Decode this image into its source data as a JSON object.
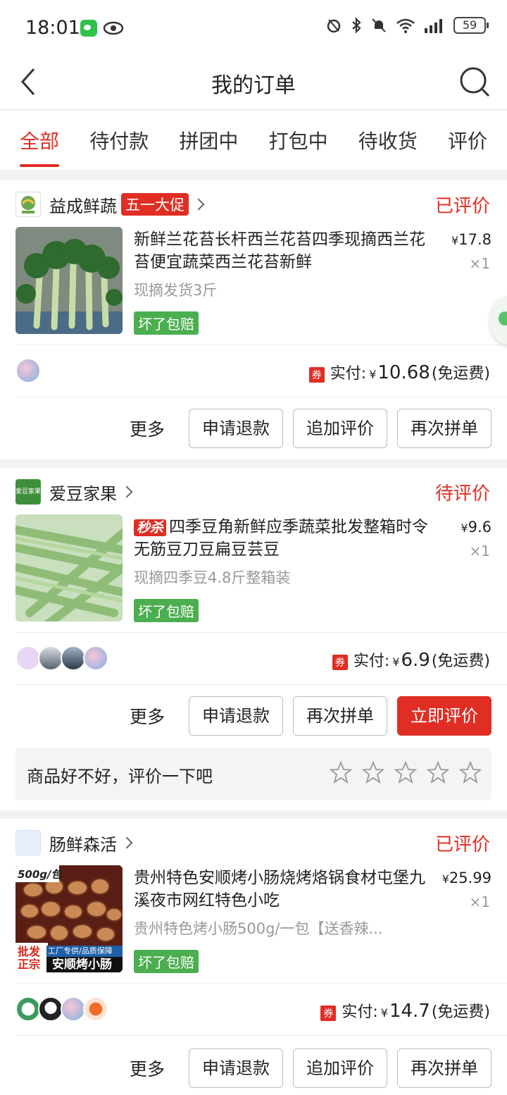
{
  "status_bar": {
    "time": "18:01",
    "battery": "59"
  },
  "header": {
    "title": "我的订单"
  },
  "tabs": [
    {
      "label": "全部"
    },
    {
      "label": "待付款"
    },
    {
      "label": "拼团中"
    },
    {
      "label": "打包中"
    },
    {
      "label": "待收货"
    },
    {
      "label": "评价"
    }
  ],
  "orders": [
    {
      "shop": "益成鲜蔬",
      "promo": "五一大促",
      "status": "已评价",
      "title": "新鲜兰花苔长杆西兰花苔四季现摘西兰花苔便宜蔬菜西兰花苔新鲜",
      "spec": "现摘发货3斤",
      "guarantee": "坏了包赔",
      "price": "17.8",
      "qty": "×1",
      "coupon": "券",
      "paid_label": "实付:",
      "paid": "10.68",
      "shipping": "(免运费)",
      "more": "更多",
      "buttons": [
        "申请退款",
        "追加评价",
        "再次拼单"
      ]
    },
    {
      "shop": "爱豆家果",
      "shop_logo_text": "爱豆家果",
      "status": "待评价",
      "seckill": "秒杀",
      "title": "四季豆角新鲜应季蔬菜批发整箱时令无筋豆刀豆扁豆芸豆",
      "spec": "现摘四季豆4.8斤整箱装",
      "guarantee": "坏了包赔",
      "price": "9.6",
      "qty": "×1",
      "coupon": "券",
      "paid_label": "实付:",
      "paid": "6.9",
      "shipping": "(免运费)",
      "more": "更多",
      "buttons": [
        "申请退款",
        "再次拼单",
        "立即评价"
      ],
      "review_prompt": "商品好不好，评价一下吧",
      "stars": 5
    },
    {
      "shop": "肠鲜森活",
      "status": "已评价",
      "title": "贵州特色安顺烤小肠烧烤烙锅食材屯堡九溪夜市网红特色小吃",
      "spec": "贵州特色烤小肠500g/一包【送香辣...",
      "guarantee": "坏了包赔",
      "price": "25.99",
      "qty": "×1",
      "img_badge": "500g/包",
      "img_tag_left": "批发正宗",
      "img_tag_right": "工厂专供/品质保障",
      "img_tag_main": "安顺烤小肠",
      "coupon": "券",
      "paid_label": "实付:",
      "paid": "14.7",
      "shipping": "(免运费)",
      "more": "更多",
      "buttons": [
        "申请退款",
        "追加评价",
        "再次拼单"
      ]
    }
  ],
  "colors": {
    "accent": "#e02e24",
    "green_tag": "#4bae4f"
  },
  "icons": [
    "back-arrow-icon",
    "search-icon",
    "chevron-right-icon",
    "star-outline-icon",
    "wechat-icon",
    "eye-icon",
    "alarm-icon",
    "bluetooth-icon",
    "mute-icon",
    "wifi-icon",
    "signal-icon",
    "battery-icon"
  ]
}
